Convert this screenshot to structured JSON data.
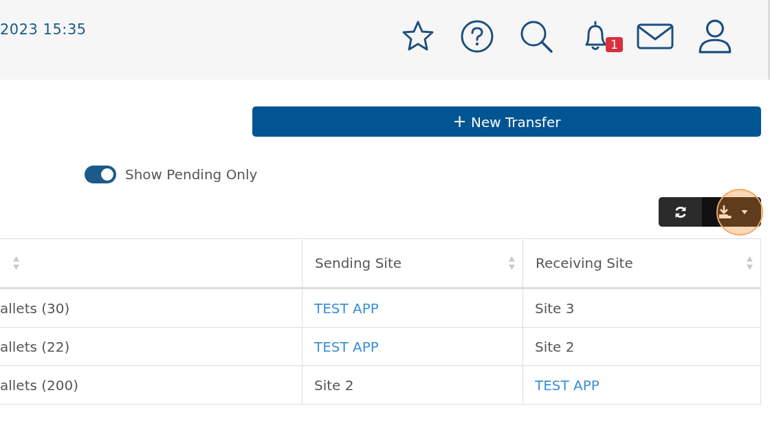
{
  "header": {
    "datetime": "2023 15:35",
    "notification_count": "1"
  },
  "new_transfer_button": {
    "icon": "+",
    "label": "New Transfer"
  },
  "pending_toggle": {
    "label": "Show Pending Only",
    "on": true
  },
  "toolbar": {
    "download_highlighted": true
  },
  "table": {
    "columns": [
      {
        "sortable": true
      },
      {
        "label": "Sending Site",
        "sortable": true
      },
      {
        "label": "Receiving Site",
        "sortable": true
      }
    ],
    "rows": [
      [
        {
          "text": "allets (30)",
          "kind": "text"
        },
        {
          "text": "TEST APP",
          "kind": "link"
        },
        {
          "text": "Site 3",
          "kind": "text"
        }
      ],
      [
        {
          "text": "allets (22)",
          "kind": "text"
        },
        {
          "text": "TEST APP",
          "kind": "link"
        },
        {
          "text": "Site 2",
          "kind": "text"
        }
      ],
      [
        {
          "text": "allets (200)",
          "kind": "text"
        },
        {
          "text": "Site 2",
          "kind": "text"
        },
        {
          "text": "TEST APP",
          "kind": "link"
        }
      ]
    ]
  }
}
